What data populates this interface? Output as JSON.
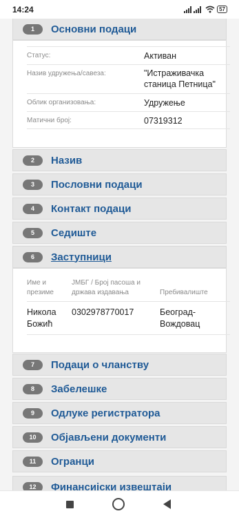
{
  "status_bar": {
    "time": "14:24",
    "battery": "57"
  },
  "sections": [
    {
      "number": "1",
      "title": "Основни подаци"
    },
    {
      "number": "2",
      "title": "Назив"
    },
    {
      "number": "3",
      "title": "Пословни подаци"
    },
    {
      "number": "4",
      "title": "Контакт подаци"
    },
    {
      "number": "5",
      "title": "Седиште"
    },
    {
      "number": "6",
      "title": "Заступници"
    },
    {
      "number": "7",
      "title": "Подаци о чланству"
    },
    {
      "number": "8",
      "title": "Забелешке"
    },
    {
      "number": "9",
      "title": "Одлуке регистратора"
    },
    {
      "number": "10",
      "title": "Објављени документи"
    },
    {
      "number": "11",
      "title": "Огранци"
    },
    {
      "number": "12",
      "title": "Финансијски извештаји"
    }
  ],
  "basic_data": {
    "status_label": "Статус:",
    "status_value": "Активан",
    "name_label": "Назив удружења/савеза:",
    "name_value_line1": "\"Истраживачка",
    "name_value_line2": "станица Петница\"",
    "form_label": "Облик организовања:",
    "form_value": "Удружење",
    "id_label": "Матични број:",
    "id_value": "07319312"
  },
  "representatives": {
    "col_name_line1": "Име и",
    "col_name_line2": "презиме",
    "col_jmbg_line1": "ЈМБГ / Број пасоша и",
    "col_jmbg_line2": "држава издавања",
    "col_residence": "Пребивалиште",
    "rows": [
      {
        "name_line1": "Никола",
        "name_line2": "Божић",
        "jmbg": "0302978770017",
        "residence_line1": "Београд-",
        "residence_line2": "Вождовац"
      }
    ]
  }
}
